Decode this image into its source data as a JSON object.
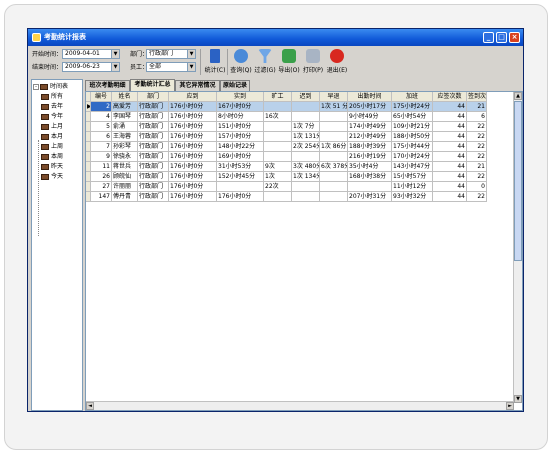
{
  "window": {
    "title": "考勤统计报表"
  },
  "filters": {
    "start_label": "开始时间：",
    "start_value": "2009-04-01",
    "end_label": "结束时间：",
    "end_value": "2009-06-23",
    "dept_label": "部门：",
    "dept_value": "行政部门",
    "staff_label": "员工：",
    "staff_value": "全部"
  },
  "toolbar": {
    "stats": "统计(C)",
    "query": "查询(Q)",
    "filter": "过滤(G)",
    "export": "导出(O)",
    "print": "打印(P)",
    "exit": "退出(E)"
  },
  "tree": {
    "root": "时间表",
    "items": [
      "所有",
      "去年",
      "今年",
      "上月",
      "本月",
      "上周",
      "本周",
      "昨天",
      "今天"
    ]
  },
  "tabs": [
    "班次考勤明细",
    "考勤统计汇总",
    "其它异常情况",
    "原始记录"
  ],
  "table": {
    "headers": [
      "编号",
      "姓名",
      "部门",
      "应到",
      "实到",
      "旷工",
      "迟到",
      "早退",
      "出勤时间",
      "加班",
      "应签次数",
      "签到次数"
    ],
    "rows": [
      [
        "2",
        "高爱芳",
        "行政部门",
        "176小时0分",
        "167小时0分",
        "",
        "",
        "1次 51 分",
        "205小时17分",
        "175小时24分",
        "44",
        "21"
      ],
      [
        "4",
        "李国琴",
        "行政部门",
        "176小时0分",
        "8小时0分",
        "16次",
        "",
        "",
        "9小时49分",
        "65小时54分",
        "44",
        "6"
      ],
      [
        "5",
        "俞涌",
        "行政部门",
        "176小时0分",
        "151小时0分",
        "",
        "1次 7分",
        "",
        "174小时49分",
        "109小时21分",
        "44",
        "22"
      ],
      [
        "6",
        "王海蓉",
        "行政部门",
        "176小时0分",
        "157小时0分",
        "",
        "1次 131分",
        "",
        "212小时49分",
        "188小时50分",
        "44",
        "22"
      ],
      [
        "7",
        "孙彩琴",
        "行政部门",
        "176小时0分",
        "148小时22分",
        "",
        "2次 254分",
        "1次 86分",
        "188小时39分",
        "175小时44分",
        "44",
        "22"
      ],
      [
        "9",
        "徐骁永",
        "行政部门",
        "176小时0分",
        "169小时0分",
        "",
        "",
        "",
        "216小时19分",
        "170小时24分",
        "44",
        "22"
      ],
      [
        "11",
        "蒋世兵",
        "行政部门",
        "176小时0分",
        "31小时53分",
        "9次",
        "3次 480分",
        "6次 378分",
        "35小时4分",
        "143小时47分",
        "44",
        "21"
      ],
      [
        "26",
        "顾皖仙",
        "行政部门",
        "176小时0分",
        "152小时45分",
        "1次",
        "1次 134分",
        "",
        "168小时38分",
        "15小时57分",
        "44",
        "22"
      ],
      [
        "27",
        "许丽丽",
        "行政部门",
        "176小时0分",
        "",
        "22次",
        "",
        "",
        "",
        "11小时12分",
        "44",
        "0"
      ],
      [
        "147",
        "傅丹青",
        "行政部门",
        "176小时0分",
        "176小时0分",
        "",
        "",
        "",
        "207小时31分",
        "93小时32分",
        "44",
        "22"
      ]
    ]
  }
}
